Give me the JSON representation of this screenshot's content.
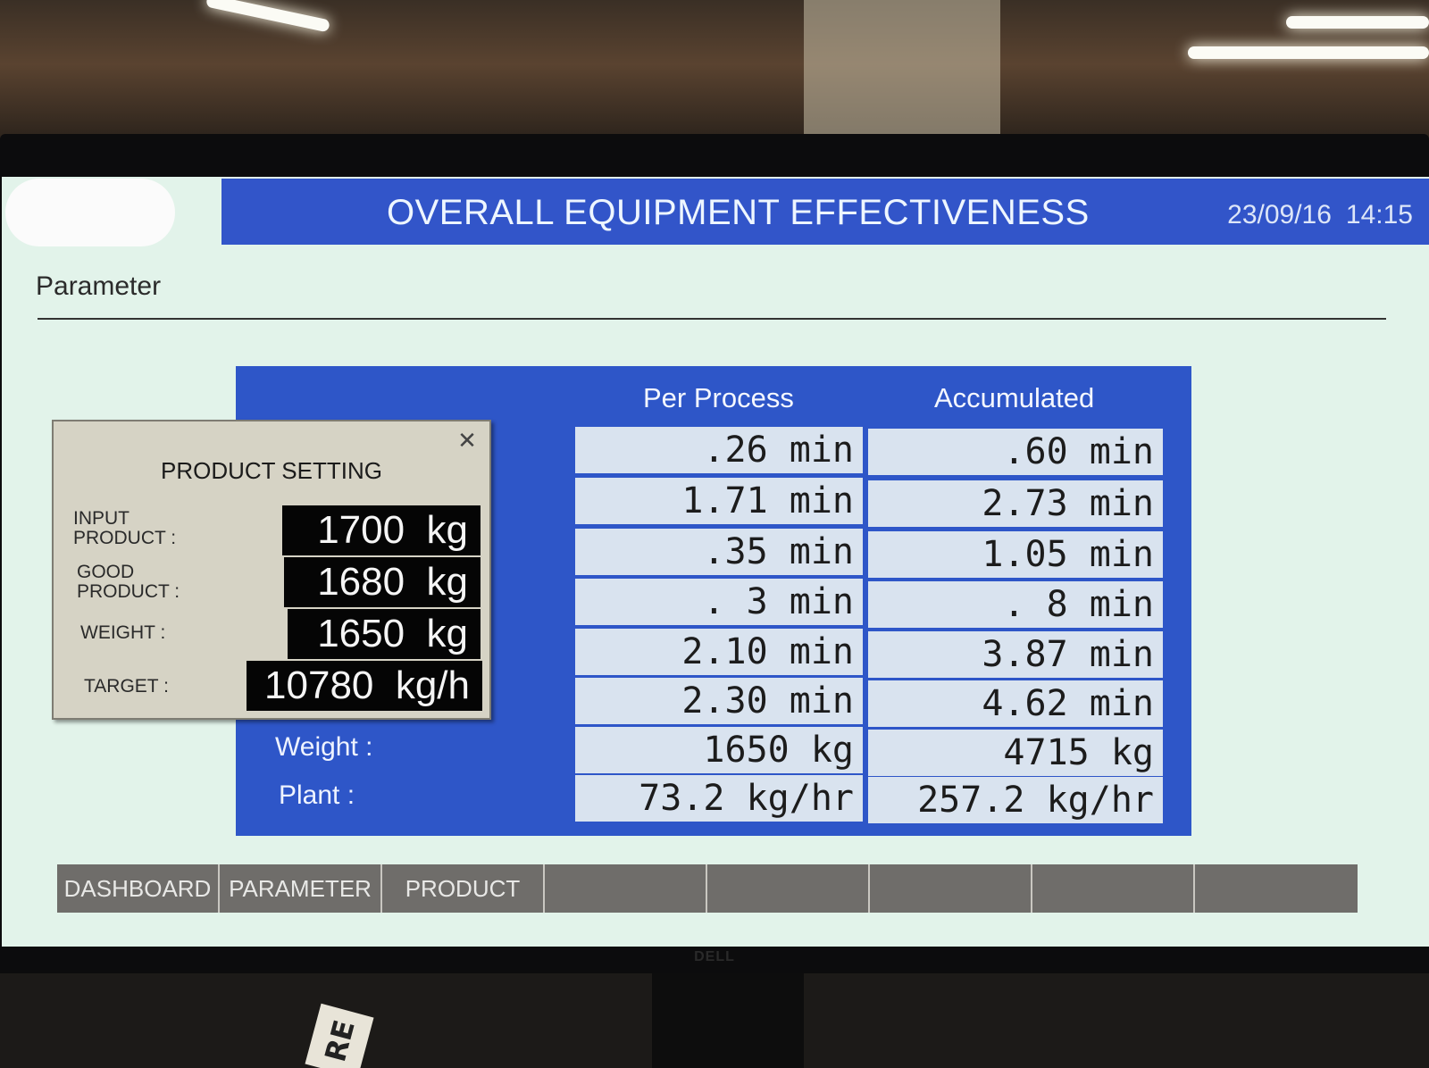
{
  "header": {
    "title": "OVERALL EQUIPMENT EFFECTIVENESS",
    "date": "23/09/16",
    "time": "14:15"
  },
  "section": {
    "title": "Parameter"
  },
  "table": {
    "columns": [
      "Per Process",
      "Accumulated"
    ],
    "rows": [
      {
        "label": "",
        "per_process": ".26 min",
        "accumulated": ".60 min"
      },
      {
        "label": "",
        "per_process": "1.71 min",
        "accumulated": "2.73 min"
      },
      {
        "label": "",
        "per_process": ".35 min",
        "accumulated": "1.05 min"
      },
      {
        "label": "",
        "per_process": ". 3 min",
        "accumulated": ". 8 min"
      },
      {
        "label": "",
        "per_process": "2.10 min",
        "accumulated": "3.87 min"
      },
      {
        "label": "",
        "per_process": "2.30 min",
        "accumulated": "4.62 min"
      },
      {
        "label": "Weight :",
        "per_process": "1650 kg",
        "accumulated": "4715 kg"
      },
      {
        "label": "Plant :",
        "per_process": "73.2 kg/hr",
        "accumulated": "257.2 kg/hr"
      }
    ]
  },
  "product_setting": {
    "title": "PRODUCT SETTING",
    "close_icon": "close-icon",
    "fields": [
      {
        "label": "INPUT\nPRODUCT :",
        "value": "1700  kg"
      },
      {
        "label": "GOOD\nPRODUCT :",
        "value": "1680  kg"
      },
      {
        "label": "WEIGHT :",
        "value": "1650  kg"
      },
      {
        "label": "TARGET :",
        "value": "10780  kg/h"
      }
    ]
  },
  "nav": {
    "items": [
      "DASHBOARD",
      "PARAMETER",
      "PRODUCT",
      "",
      "",
      "",
      "",
      ""
    ]
  },
  "monitor": {
    "brand": "DELL"
  },
  "colors": {
    "title_bar": "#3255c9",
    "screen_background": "#e2f3ea",
    "panel": "#2e56c8",
    "cell": "#d9e3ef",
    "nav": "#6f6d6a"
  }
}
